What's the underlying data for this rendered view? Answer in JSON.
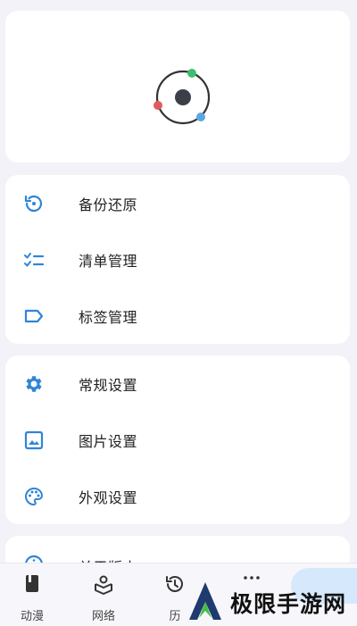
{
  "groups": [
    {
      "items": [
        {
          "label": "备份还原",
          "icon": "backup-restore-icon"
        },
        {
          "label": "清单管理",
          "icon": "checklist-icon"
        },
        {
          "label": "标签管理",
          "icon": "tag-icon"
        }
      ]
    },
    {
      "items": [
        {
          "label": "常规设置",
          "icon": "gear-icon"
        },
        {
          "label": "图片设置",
          "icon": "image-icon"
        },
        {
          "label": "外观设置",
          "icon": "palette-icon"
        }
      ]
    },
    {
      "items": [
        {
          "label": "关于版本",
          "icon": "info-icon"
        }
      ]
    }
  ],
  "bottom_nav": [
    {
      "label": "动漫",
      "icon": "book-icon"
    },
    {
      "label": "网络",
      "icon": "network-icon"
    },
    {
      "label": "历",
      "icon": "history-icon"
    },
    {
      "label": "",
      "icon": "more-icon"
    }
  ],
  "watermark": {
    "text": "极限手游网"
  },
  "colors": {
    "accent": "#2f86d6",
    "background": "#f3f2f8",
    "card": "#ffffff"
  }
}
